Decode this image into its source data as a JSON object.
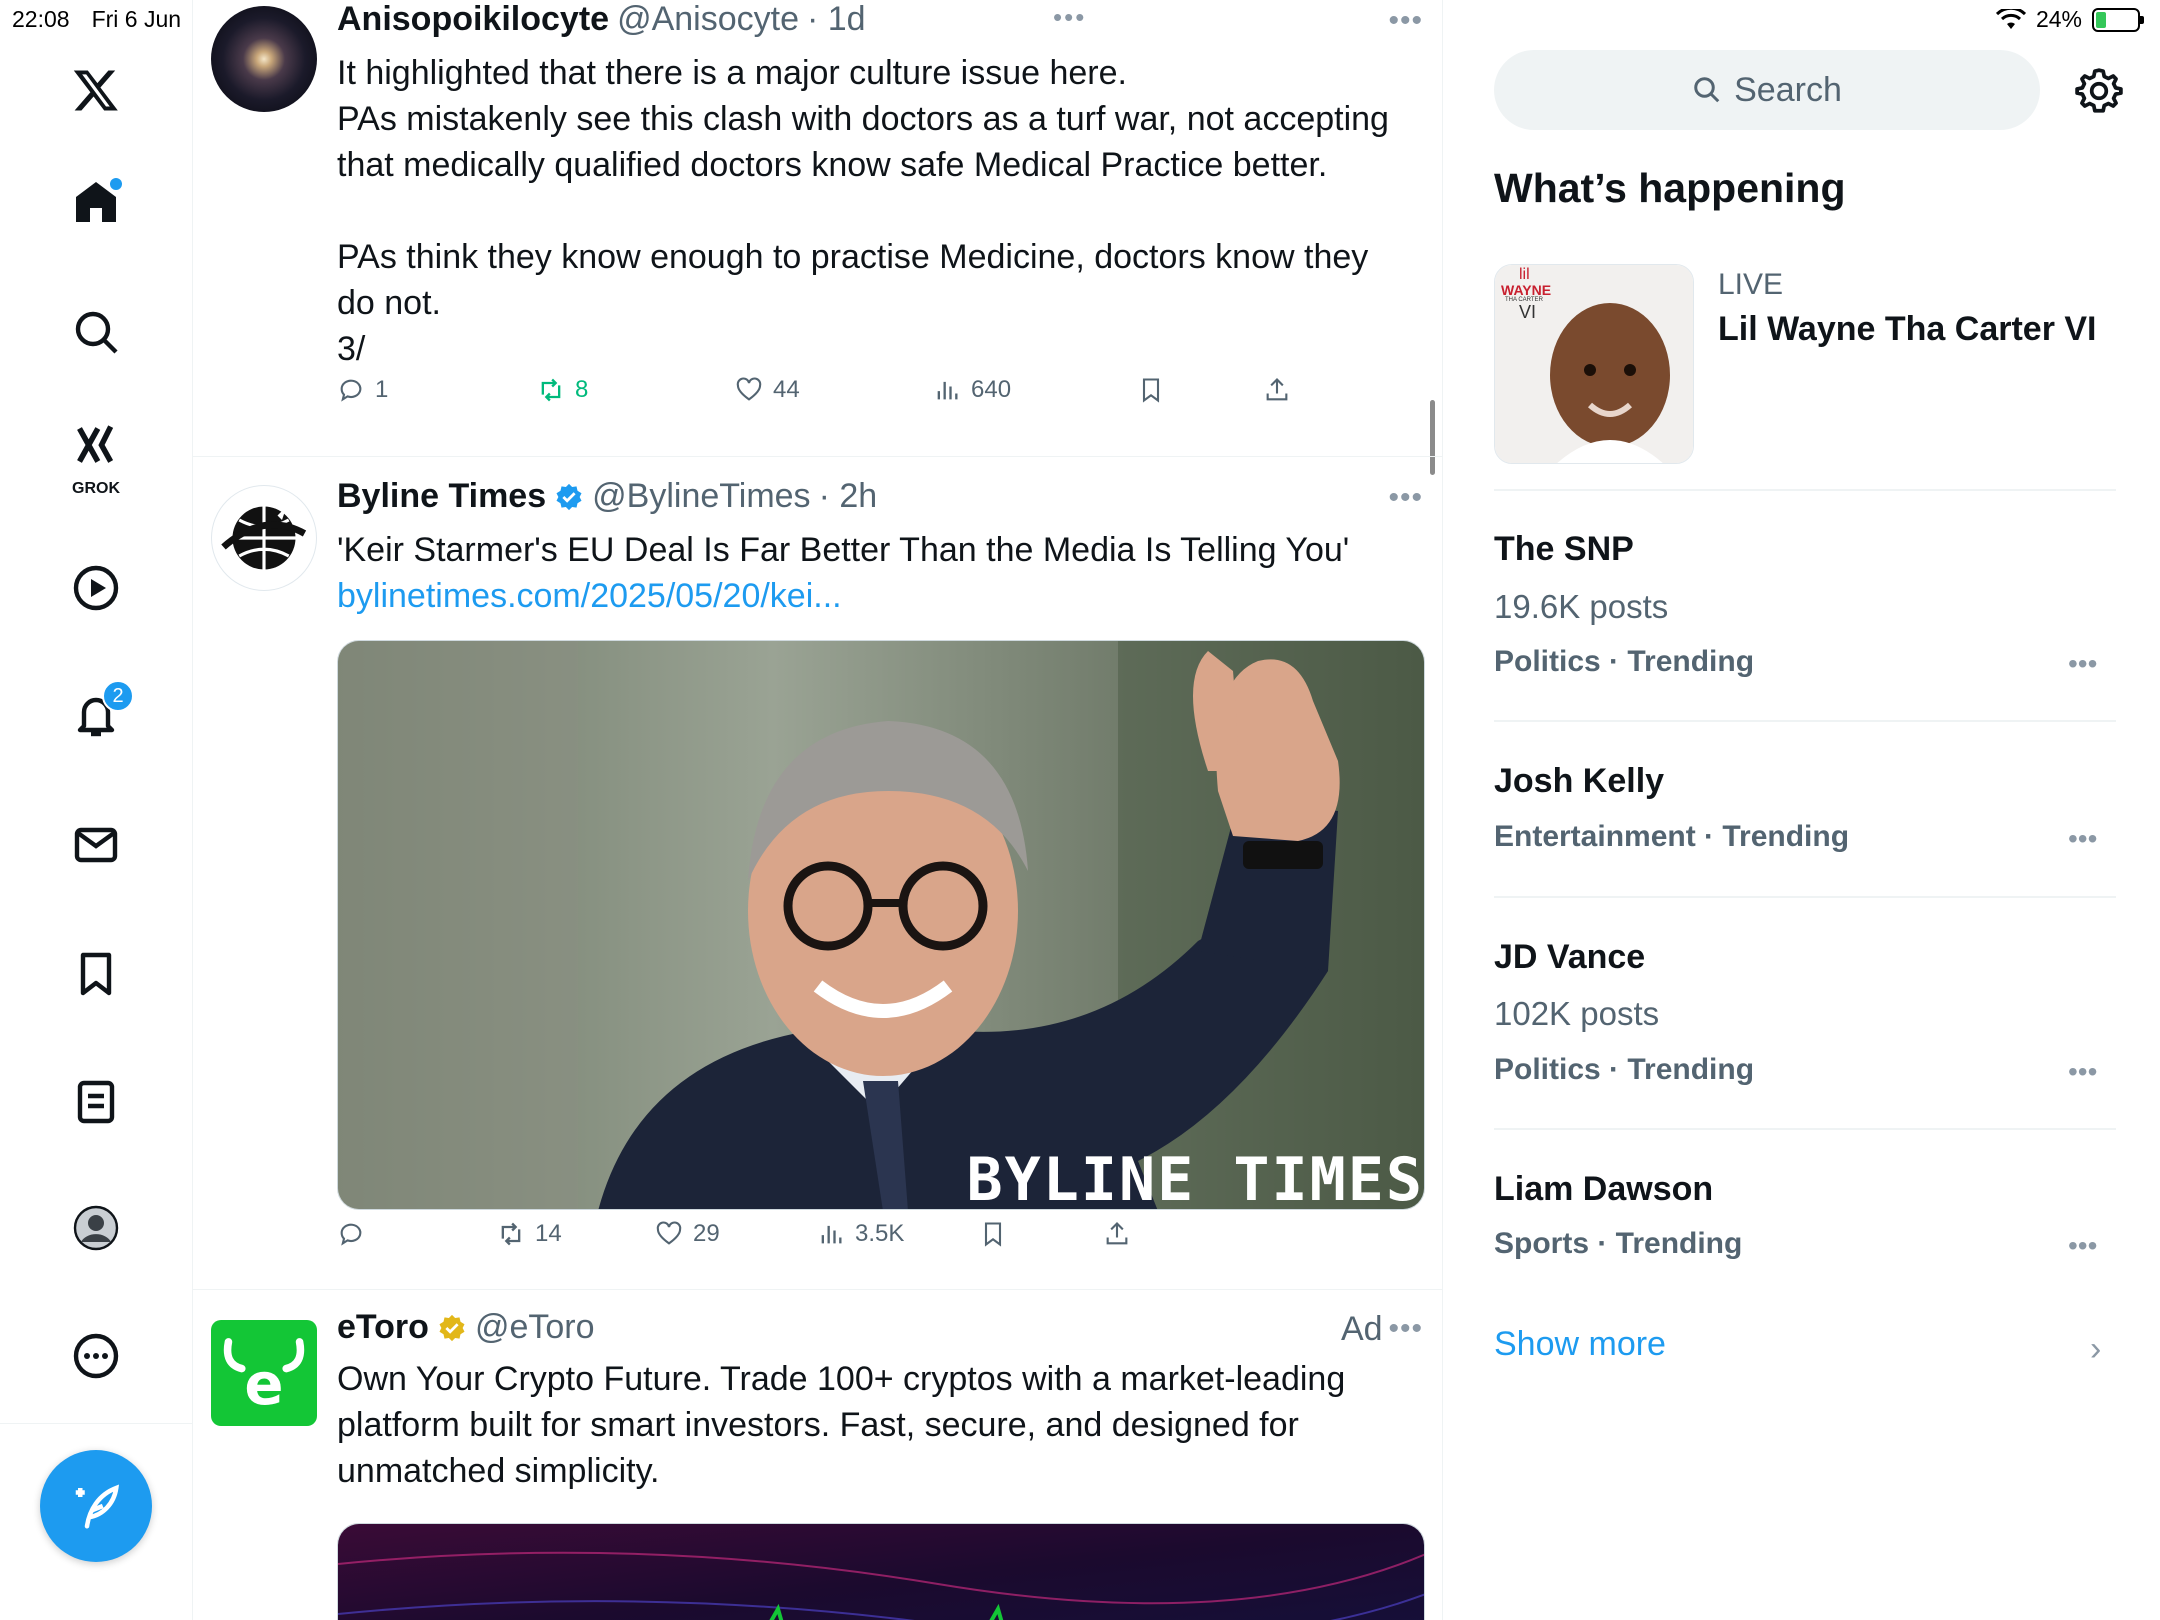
{
  "status_bar": {
    "time": "22:08",
    "date": "Fri 6 Jun",
    "battery": "24%"
  },
  "nav": {
    "notifications_badge": "2",
    "grok_label": "GROK"
  },
  "feed": {
    "top_dots": "•••",
    "tweets": [
      {
        "name": "Anisopoikilocyte",
        "handle": "@Anisocyte",
        "time": "· 1d",
        "lines": [
          "It highlighted that there is a major culture issue here.",
          "PAs mistakenly see this clash with doctors as a turf war, not accepting",
          "that medically qualified doctors know safe Medical Practice better.",
          "",
          "PAs think they know enough to practise Medicine, doctors know they",
          "do not.",
          "3/"
        ],
        "replies": "1",
        "reposts": "8",
        "likes": "44",
        "views": "640"
      },
      {
        "name": "Byline Times",
        "handle": "@BylineTimes",
        "time": "· 2h",
        "text": "'Keir Starmer's EU Deal Is Far Better Than the Media Is Telling You'",
        "link": "bylinetimes.com/2025/05/20/kei...",
        "watermark": "BYLINE TIMES",
        "replies": "",
        "reposts": "14",
        "likes": "29",
        "views": "3.5K"
      },
      {
        "name": "eToro",
        "handle": "@eToro",
        "ad_label": "Ad",
        "lines": [
          "Own Your Crypto Future. Trade 100+ cryptos with a market-leading",
          "platform built for smart investors. Fast, secure, and designed for",
          "unmatched simplicity."
        ]
      }
    ]
  },
  "sidebar": {
    "search_placeholder": "Search",
    "whats_happening": "What’s happening",
    "live": {
      "label": "LIVE",
      "title": "Lil Wayne Tha Carter VI",
      "art_text_1": "lil",
      "art_text_2": "WAYNE",
      "art_text_3": "THA CARTER",
      "art_text_4": "VI"
    },
    "trends": [
      {
        "name": "The SNP",
        "posts": "19.6K posts",
        "category": "Politics · Trending"
      },
      {
        "name": "Josh Kelly",
        "posts": "",
        "category": "Entertainment · Trending"
      },
      {
        "name": "JD Vance",
        "posts": "102K posts",
        "category": "Politics · Trending"
      },
      {
        "name": "Liam Dawson",
        "posts": "",
        "category": "Sports · Trending"
      }
    ],
    "show_more": "Show more"
  },
  "colors": {
    "accent": "#1d9bf0",
    "repost_green": "#00ba7c",
    "etoro_green": "#13c636",
    "text_secondary": "#536471"
  }
}
